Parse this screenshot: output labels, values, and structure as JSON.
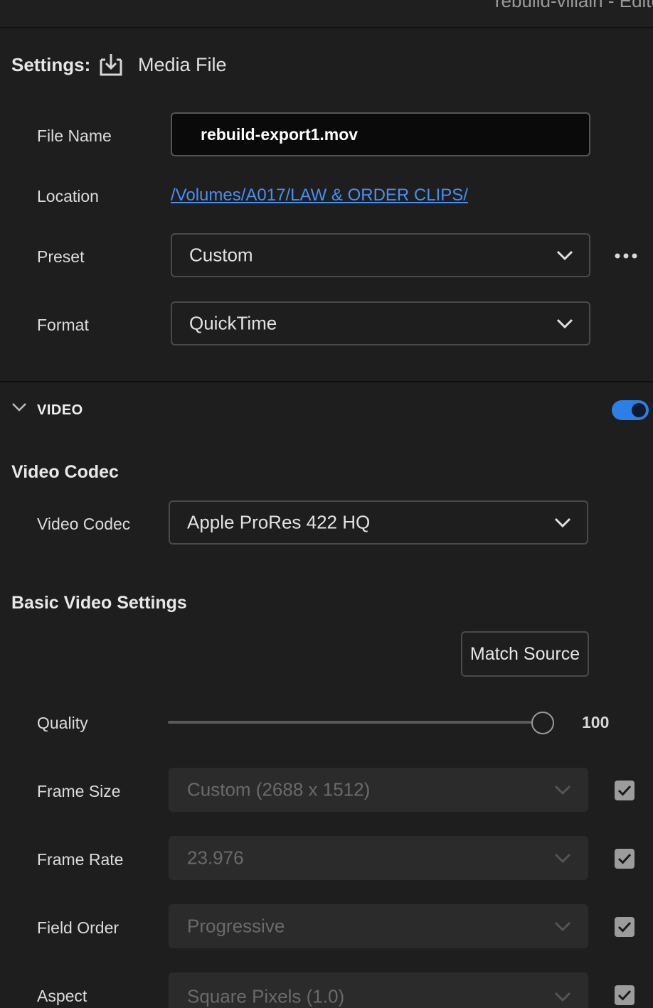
{
  "window": {
    "title": "rebuild-villain - Edite"
  },
  "settings": {
    "label": "Settings:",
    "destination": "Media File",
    "file_name_label": "File Name",
    "file_name_value": "rebuild-export1.mov",
    "location_label": "Location",
    "location_value": "/Volumes/A017/LAW & ORDER CLIPS/",
    "preset_label": "Preset",
    "preset_value": "Custom",
    "format_label": "Format",
    "format_value": "QuickTime"
  },
  "video": {
    "section_title": "VIDEO",
    "enabled": true,
    "codec_heading": "Video Codec",
    "codec_label": "Video Codec",
    "codec_value": "Apple ProRes 422 HQ",
    "basic_heading": "Basic Video Settings",
    "match_source_label": "Match Source",
    "quality_label": "Quality",
    "quality_value": 100,
    "quality_max": 100,
    "frame_size_label": "Frame Size",
    "frame_size_value": "Custom (2688 x 1512)",
    "frame_size_checked": true,
    "frame_rate_label": "Frame Rate",
    "frame_rate_value": "23.976",
    "frame_rate_checked": true,
    "field_order_label": "Field Order",
    "field_order_value": "Progressive",
    "field_order_checked": true,
    "aspect_label": "Aspect",
    "aspect_value": "Square Pixels (1.0)",
    "aspect_checked": true
  },
  "colors": {
    "accent": "#2b7fe6",
    "link": "#4a8ff0",
    "background": "#1e1e1e"
  }
}
